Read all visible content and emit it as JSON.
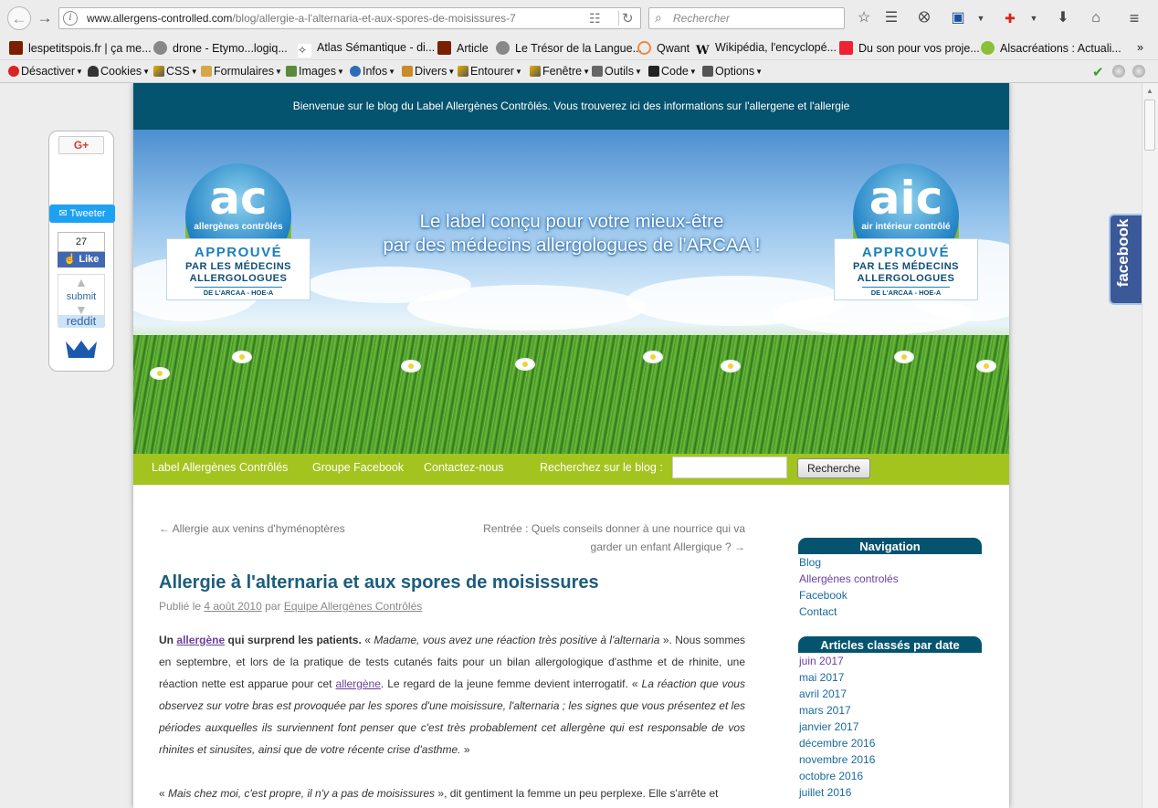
{
  "browser": {
    "url_domain": "www.allergens-controlled.com",
    "url_path": "/blog/allergie-a-l'alternaria-et-aux-spores-de-moisissures-7",
    "search_placeholder": "Rechercher",
    "bookmarks": [
      "lespetitspois.fr | ça me...",
      "drone - Etymo...logiq...",
      "Atlas Sémantique - di...",
      "Article",
      "Le Trésor de la Langue...",
      "Qwant",
      "Wikipédia, l'encyclopé...",
      "Du son pour vos proje...",
      "Alsacréations : Actuali..."
    ],
    "bookmarks_more": "»",
    "devtools": [
      "Désactiver",
      "Cookies",
      "CSS",
      "Formulaires",
      "Images",
      "Infos",
      "Divers",
      "Entourer",
      "Fenêtre",
      "Outils",
      "Code",
      "Options"
    ]
  },
  "share": {
    "gplus": "G+",
    "tweet": "Tweeter",
    "like_count": "27",
    "like": "Like",
    "submit": "submit",
    "reddit": "reddit"
  },
  "site": {
    "welcome": "Bienvenue sur le blog du Label Allergènes Contrôlés. Vous trouverez ici des informations sur l'allergene et l'allergie",
    "tagline_1": "Le label conçu pour votre mieux-être",
    "tagline_2": "par des médecins allergologues de l'ARCAA !",
    "logo_left": {
      "brand": "ac",
      "sub": "allergènes contrôlés"
    },
    "logo_right": {
      "brand": "aic",
      "sub": "air intérieur contrôlé"
    },
    "logo_approved": "APPROUVÉ",
    "logo_par": "PAR LES MÉDECINS",
    "logo_allerg": "ALLERGOLOGUES",
    "logo_arcaa": "DE L'ARCAA - HOE-A",
    "menu": [
      "Label Allergènes Contrôlés",
      "Groupe Facebook",
      "Contactez-nous"
    ],
    "search_label": "Recherchez sur le blog :",
    "search_button": "Recherche",
    "facebook_tab": "facebook"
  },
  "article": {
    "prev": "← Allergie aux venins d'hyménoptères",
    "next_1": "Rentrée : Quels conseils donner à une nourrice qui va",
    "next_2": "garder un enfant Allergique ? →",
    "title": "Allergie à l'alternaria et aux spores de moisissures",
    "meta_published": "Publié le",
    "meta_date": "4 août 2010",
    "meta_by": "par",
    "meta_author": "Equipe Allergènes Contrôlés",
    "p1_lead_a": "Un",
    "p1_lead_link": "allergène",
    "p1_lead_b": "qui surprend les patients.",
    "p1_q1": "Madame, vous avez une réaction très positive à l'alternaria",
    "p1_t1": "». Nous sommes en septembre, et lors de la pratique de tests cutanés faits pour un bilan allergologique d'asthme et de rhinite, une réaction nette est apparue pour cet",
    "p1_link2": "allergène",
    "p1_t2": ". Le regard de la jeune femme devient interrogatif. «",
    "p1_q2": "La réaction que vous observez sur votre bras est provoquée par les spores d'une moisissure, l'alternaria ; les signes que vous présentez et les périodes auxquelles ils surviennent font penser que c'est très probablement cet allergène qui est responsable de vos rhinites et sinusites, ainsi que de votre récente crise d'asthme.",
    "p1_end": "»",
    "p2_q": "Mais chez moi, c'est propre, il n'y a pas de moisissures",
    "p2_t": "», dit gentiment la femme un peu perplexe. Elle s'arrête et"
  },
  "sidebar": {
    "nav_title": "Navigation",
    "nav_items": [
      "Blog",
      "Allergènes controlés",
      "Facebook",
      "Contact"
    ],
    "archive_title": "Articles classés par date",
    "archive_items": [
      "juin 2017",
      "mai 2017",
      "avril 2017",
      "mars 2017",
      "janvier 2017",
      "décembre 2016",
      "novembre 2016",
      "octobre 2016",
      "juillet 2016"
    ]
  }
}
